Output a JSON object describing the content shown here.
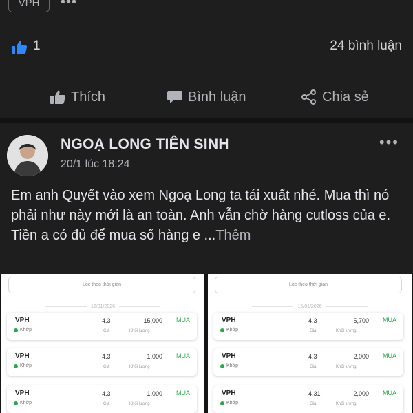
{
  "top": {
    "tag": "VPH",
    "more": "•••"
  },
  "reactions": {
    "like_count": "1",
    "comment_count": "24 bình luận"
  },
  "actions": {
    "like": "Thích",
    "comment": "Bình luận",
    "share": "Chia sẻ"
  },
  "post": {
    "author": "NGOẠ LONG TIÊN SINH",
    "time": "20/1 lúc 18:24",
    "more": "•••",
    "text": "Em anh Quyết vào xem Ngoạ Long ta tái xuất nhé. Mua thì nó phải như này mới là an toàn. Anh vẫn chờ hàng cutloss của e. Tiền a có đủ để mua số hàng e ...",
    "see_more": "Thêm"
  },
  "screens": [
    {
      "filter": "Lọc theo thời gian",
      "date": "12/01/2026",
      "rows": [
        {
          "symbol": "VPH",
          "status": "Khớp",
          "price": "4.3",
          "qty": "15,000",
          "side": "MUA",
          "price_label": "Giá",
          "qty_label": "Khối lượng"
        },
        {
          "symbol": "VPH",
          "status": "Khớp",
          "price": "4.3",
          "qty": "1,000",
          "side": "MUA",
          "price_label": "Giá",
          "qty_label": "Khối lượng"
        },
        {
          "symbol": "VPH",
          "status": "Khớp",
          "price": "4.3",
          "qty": "1,000",
          "side": "MUA",
          "price_label": "Giá",
          "qty_label": "Khối lượng"
        }
      ]
    },
    {
      "filter": "Lọc theo thời gian",
      "date": "15/01/2026",
      "rows": [
        {
          "symbol": "VPH",
          "status": "Khớp",
          "price": "4.3",
          "qty": "5,700",
          "side": "MUA",
          "price_label": "Giá",
          "qty_label": "Khối lượng"
        },
        {
          "symbol": "VPH",
          "status": "Khớp",
          "price": "4.3",
          "qty": "2,000",
          "side": "MUA",
          "price_label": "Giá",
          "qty_label": "Khối lượng"
        },
        {
          "symbol": "VPH",
          "status": "Khớp",
          "price": "4.31",
          "qty": "2,000",
          "side": "MUA",
          "price_label": "Giá",
          "qty_label": "Khối lượng"
        }
      ]
    }
  ],
  "colors": {
    "accent_blue": "#2d88ff",
    "buy_green": "#2aa84a",
    "background": "#1e1e1e"
  }
}
